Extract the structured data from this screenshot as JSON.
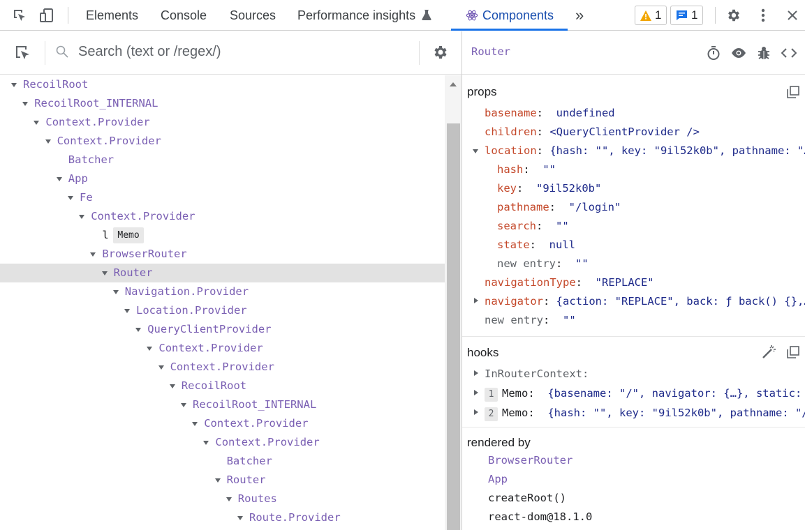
{
  "toolbar": {
    "tabs": [
      {
        "label": "Elements"
      },
      {
        "label": "Console"
      },
      {
        "label": "Sources"
      },
      {
        "label": "Performance insights"
      },
      {
        "label": "Components"
      }
    ],
    "more_label": "»",
    "warnings_count": "1",
    "messages_count": "1"
  },
  "search": {
    "placeholder": "Search (text or /regex/)"
  },
  "tree": {
    "rows": [
      {
        "label": "RecoilRoot",
        "expanded": true
      },
      {
        "label": "RecoilRoot_INTERNAL",
        "expanded": true
      },
      {
        "label": "Context.Provider",
        "expanded": true
      },
      {
        "label": "Context.Provider",
        "expanded": true
      },
      {
        "label": "Batcher",
        "expanded": false
      },
      {
        "label": "App",
        "expanded": true
      },
      {
        "label": "Fe",
        "expanded": true
      },
      {
        "label": "Context.Provider",
        "expanded": true
      },
      {
        "label": "l",
        "expanded": false,
        "badge": "Memo"
      },
      {
        "label": "BrowserRouter",
        "expanded": true
      },
      {
        "label": "Router",
        "expanded": true,
        "selected": true
      },
      {
        "label": "Navigation.Provider",
        "expanded": true
      },
      {
        "label": "Location.Provider",
        "expanded": true
      },
      {
        "label": "QueryClientProvider",
        "expanded": true
      },
      {
        "label": "Context.Provider",
        "expanded": true
      },
      {
        "label": "Context.Provider",
        "expanded": true
      },
      {
        "label": "RecoilRoot",
        "expanded": true
      },
      {
        "label": "RecoilRoot_INTERNAL",
        "expanded": true
      },
      {
        "label": "Context.Provider",
        "expanded": true
      },
      {
        "label": "Context.Provider",
        "expanded": true
      },
      {
        "label": "Batcher",
        "expanded": false
      },
      {
        "label": "Router",
        "expanded": true
      },
      {
        "label": "Routes",
        "expanded": true
      },
      {
        "label": "Route.Provider",
        "expanded": true
      }
    ]
  },
  "inspector": {
    "title": "Router",
    "props": {
      "heading": "props",
      "rows": [
        {
          "key": "basename",
          "value": "undefined"
        },
        {
          "key": "children",
          "value": "<QueryClientProvider />"
        },
        {
          "key": "location",
          "value": "{hash: \"\", key: \"9il52k0b\", pathname: \"…",
          "expanded": true
        },
        {
          "key": "hash",
          "value": "\"\""
        },
        {
          "key": "key",
          "value": "\"9il52k0b\""
        },
        {
          "key": "pathname",
          "value": "\"/login\""
        },
        {
          "key": "search",
          "value": "\"\""
        },
        {
          "key": "state",
          "value": "null"
        },
        {
          "key": "new entry",
          "value": "\"\""
        },
        {
          "key": "navigationType",
          "value": "\"REPLACE\""
        },
        {
          "key": "navigator",
          "value": "{action: \"REPLACE\", back: ƒ back() {},…",
          "expanded": false
        },
        {
          "key": "new entry",
          "value": "\"\""
        }
      ]
    },
    "hooks": {
      "heading": "hooks",
      "rows": [
        {
          "label": "InRouterContext:"
        },
        {
          "num": "1",
          "key": "Memo:",
          "value": "{basename: \"/\", navigator: {…}, static: …"
        },
        {
          "num": "2",
          "key": "Memo:",
          "value": "{hash: \"\", key: \"9il52k0b\", pathname: \"/…"
        }
      ]
    },
    "rendered_by": {
      "heading": "rendered by",
      "items": [
        "BrowserRouter",
        "App",
        "createRoot()",
        "react-dom@18.1.0"
      ]
    }
  },
  "colors": {
    "component": "#7a5fb3",
    "prop_key": "#c4482a",
    "value": "#1e2a8a",
    "accent": "#1a73e8"
  }
}
